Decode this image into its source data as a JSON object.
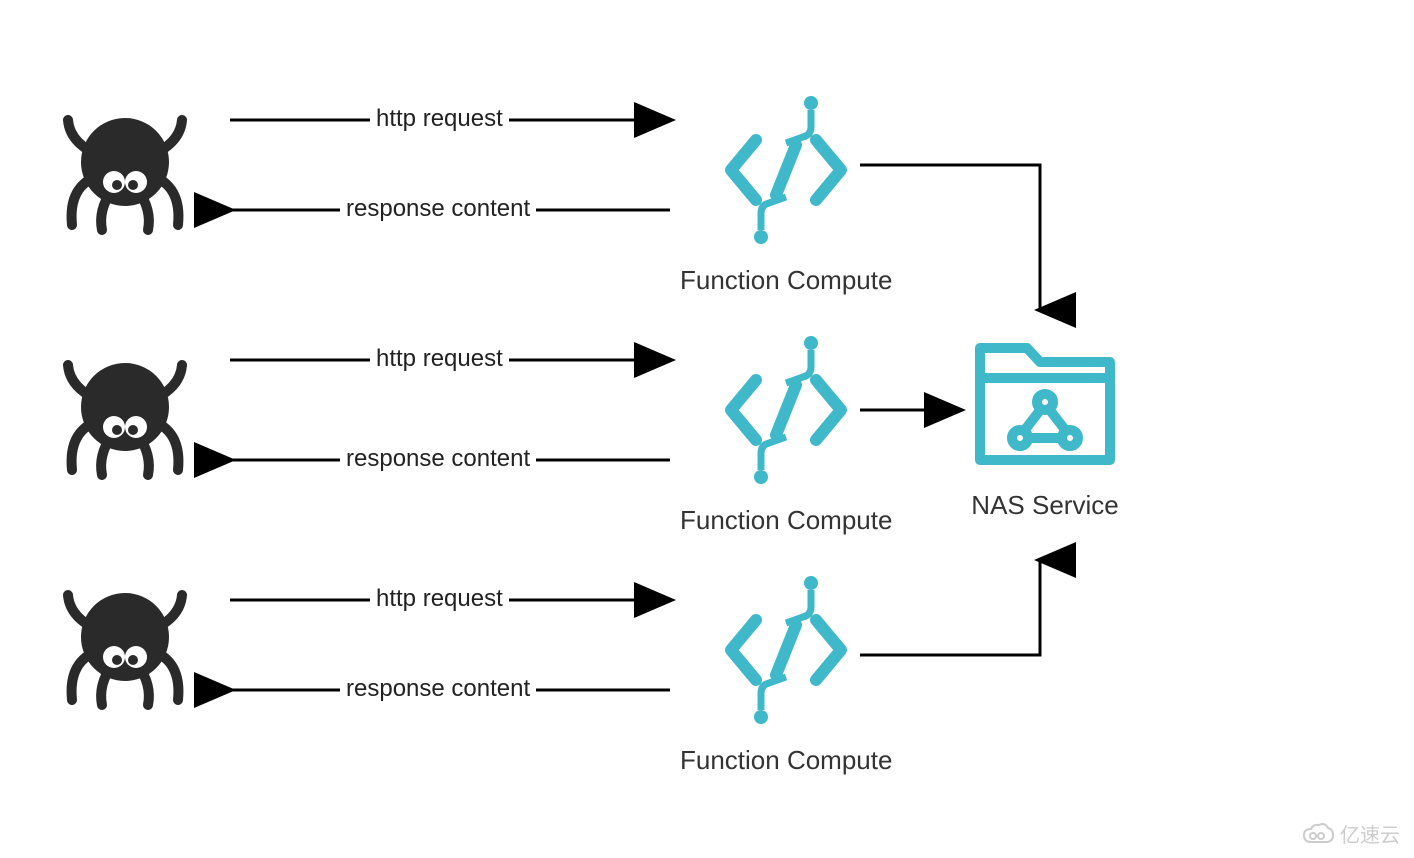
{
  "diagram": {
    "clients": [
      {
        "type": "crawler",
        "requestLabel": "http request",
        "responseLabel": "response content"
      },
      {
        "type": "crawler",
        "requestLabel": "http request",
        "responseLabel": "response content"
      },
      {
        "type": "crawler",
        "requestLabel": "http request",
        "responseLabel": "response content"
      }
    ],
    "compute": [
      {
        "label": "Function Compute"
      },
      {
        "label": "Function Compute"
      },
      {
        "label": "Function Compute"
      }
    ],
    "storage": {
      "label": "NAS Service"
    }
  },
  "watermark": "亿速云"
}
